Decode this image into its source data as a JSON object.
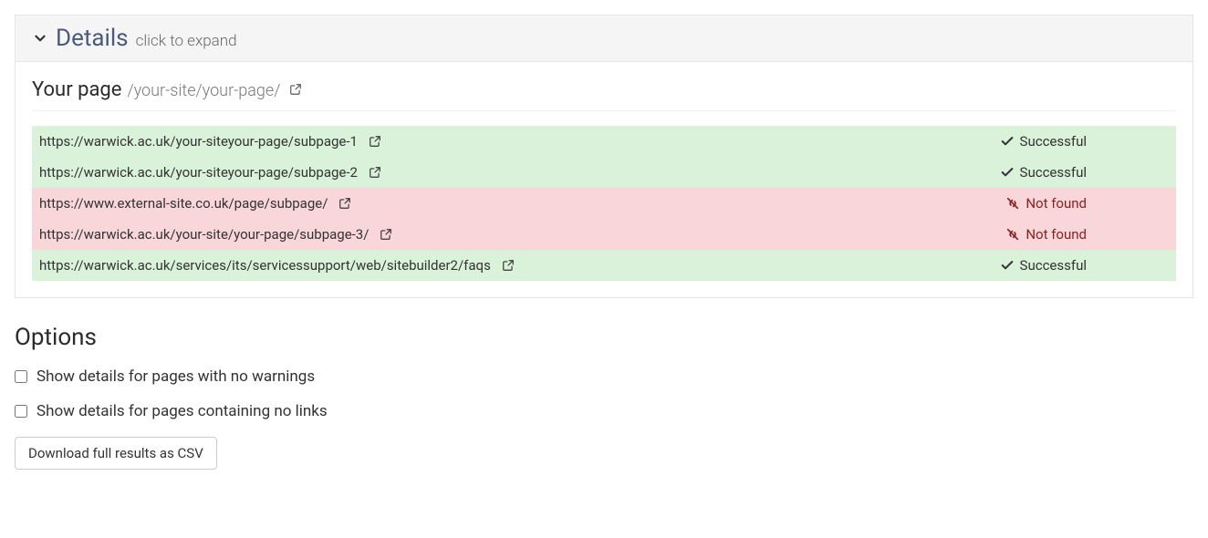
{
  "details": {
    "title": "Details",
    "subtitle": "click to expand",
    "page": {
      "label": "Your page",
      "path": "/your-site/your-page/"
    },
    "rows": [
      {
        "url": "https://warwick.ac.uk/your-siteyour-page/subpage-1",
        "status": "Successful",
        "state": "success"
      },
      {
        "url": "https://warwick.ac.uk/your-siteyour-page/subpage-2",
        "status": "Successful",
        "state": "success"
      },
      {
        "url": "https://www.external-site.co.uk/page/subpage/",
        "status": "Not found",
        "state": "notfound"
      },
      {
        "url": "https://warwick.ac.uk/your-site/your-page/subpage-3/",
        "status": "Not found",
        "state": "notfound"
      },
      {
        "url": "https://warwick.ac.uk/services/its/servicessupport/web/sitebuilder2/faqs",
        "status": "Successful",
        "state": "success"
      }
    ]
  },
  "options": {
    "title": "Options",
    "opt1": "Show details for pages with no warnings",
    "opt2": "Show details for pages containing no links",
    "download": "Download full results as CSV"
  }
}
